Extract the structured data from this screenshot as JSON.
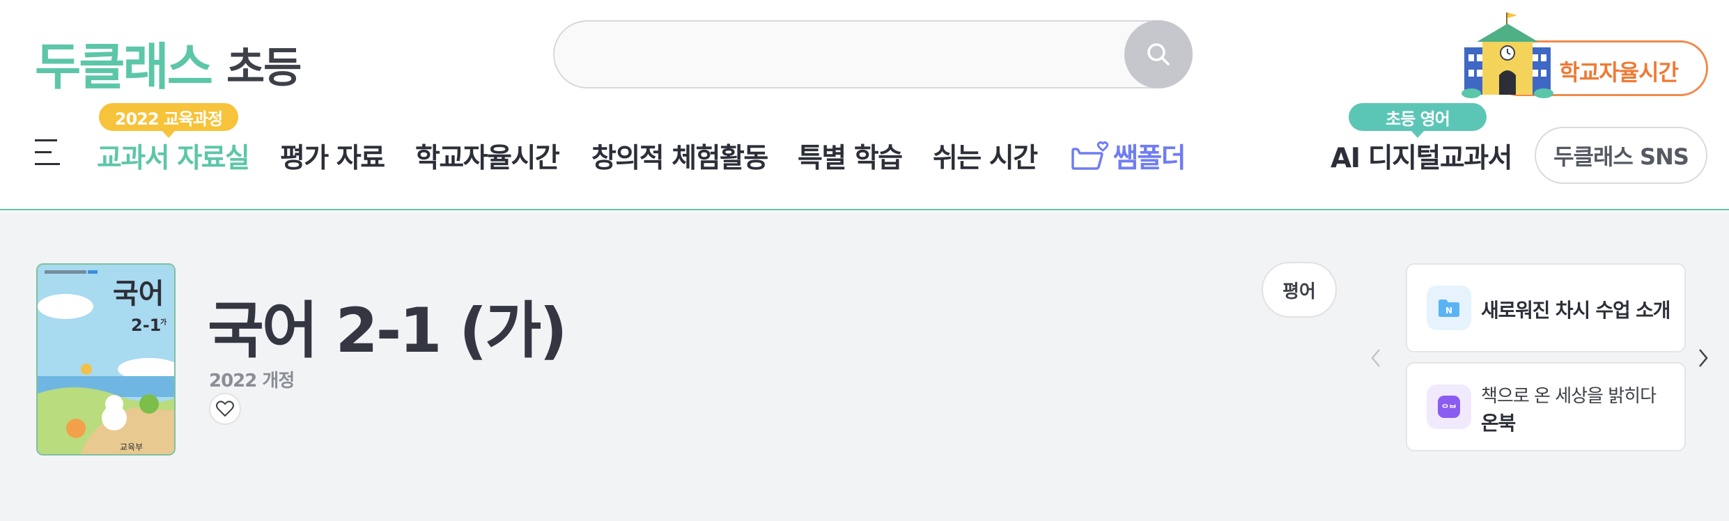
{
  "header": {
    "logo_main": "두클래스",
    "logo_sub": "초등",
    "search_placeholder": "",
    "school_button": "학교자율시간"
  },
  "nav": {
    "badge_curriculum": "2022 교육과정",
    "items": [
      {
        "label": "교과서 자료실"
      },
      {
        "label": "평가 자료"
      },
      {
        "label": "학교자율시간"
      },
      {
        "label": "창의적 체험활동"
      },
      {
        "label": "특별 학습"
      },
      {
        "label": "쉬는 시간"
      },
      {
        "label": "쌤폴더"
      }
    ],
    "badge_english": "초등 영어",
    "ai_textbook": "AI 디지털교과서",
    "sns_button": "두클래스 SNS"
  },
  "book": {
    "title": "국어 2-1 (가)",
    "revision": "2022 개정",
    "cover_title": "국어",
    "cover_grade": "2-1",
    "cover_grade_mark": "가",
    "cover_publisher": "교육부",
    "review_button": "평어"
  },
  "cards": [
    {
      "title": "새로워진 차시 수업 소개",
      "icon": "folder-n-icon",
      "icon_glyph": "N"
    },
    {
      "subtitle": "책으로 온 세상을 밝히다",
      "title": "온북",
      "icon": "onbook-icon",
      "icon_glyph": "ᄋᄇ"
    }
  ],
  "colors": {
    "brand_green": "#5cc6a8",
    "accent_orange": "#ee7a35",
    "folder_blue": "#6f7df2",
    "badge_yellow": "#f6c33a",
    "onbook_purple": "#8a5cf0"
  }
}
